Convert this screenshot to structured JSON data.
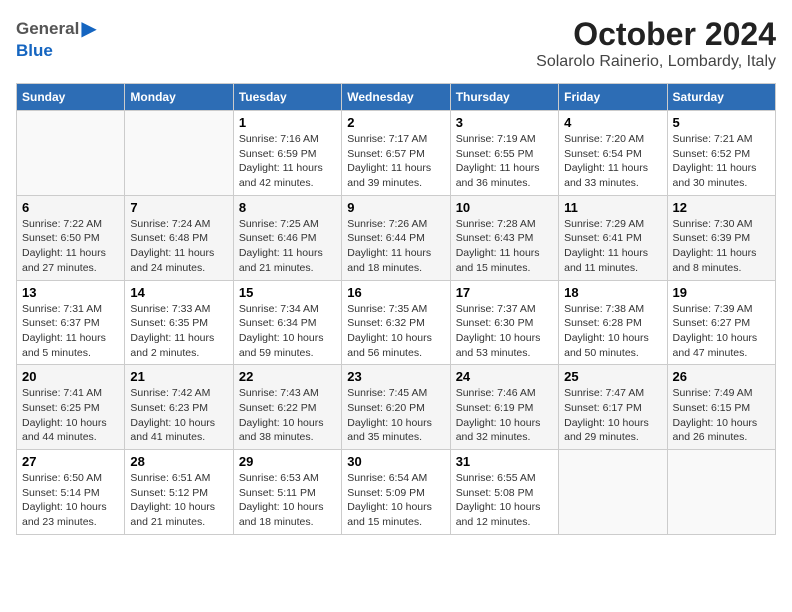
{
  "header": {
    "logo_general": "General",
    "logo_blue": "Blue",
    "month": "October 2024",
    "location": "Solarolo Rainerio, Lombardy, Italy"
  },
  "weekdays": [
    "Sunday",
    "Monday",
    "Tuesday",
    "Wednesday",
    "Thursday",
    "Friday",
    "Saturday"
  ],
  "weeks": [
    [
      {
        "day": "",
        "info": ""
      },
      {
        "day": "",
        "info": ""
      },
      {
        "day": "1",
        "info": "Sunrise: 7:16 AM\nSunset: 6:59 PM\nDaylight: 11 hours and 42 minutes."
      },
      {
        "day": "2",
        "info": "Sunrise: 7:17 AM\nSunset: 6:57 PM\nDaylight: 11 hours and 39 minutes."
      },
      {
        "day": "3",
        "info": "Sunrise: 7:19 AM\nSunset: 6:55 PM\nDaylight: 11 hours and 36 minutes."
      },
      {
        "day": "4",
        "info": "Sunrise: 7:20 AM\nSunset: 6:54 PM\nDaylight: 11 hours and 33 minutes."
      },
      {
        "day": "5",
        "info": "Sunrise: 7:21 AM\nSunset: 6:52 PM\nDaylight: 11 hours and 30 minutes."
      }
    ],
    [
      {
        "day": "6",
        "info": "Sunrise: 7:22 AM\nSunset: 6:50 PM\nDaylight: 11 hours and 27 minutes."
      },
      {
        "day": "7",
        "info": "Sunrise: 7:24 AM\nSunset: 6:48 PM\nDaylight: 11 hours and 24 minutes."
      },
      {
        "day": "8",
        "info": "Sunrise: 7:25 AM\nSunset: 6:46 PM\nDaylight: 11 hours and 21 minutes."
      },
      {
        "day": "9",
        "info": "Sunrise: 7:26 AM\nSunset: 6:44 PM\nDaylight: 11 hours and 18 minutes."
      },
      {
        "day": "10",
        "info": "Sunrise: 7:28 AM\nSunset: 6:43 PM\nDaylight: 11 hours and 15 minutes."
      },
      {
        "day": "11",
        "info": "Sunrise: 7:29 AM\nSunset: 6:41 PM\nDaylight: 11 hours and 11 minutes."
      },
      {
        "day": "12",
        "info": "Sunrise: 7:30 AM\nSunset: 6:39 PM\nDaylight: 11 hours and 8 minutes."
      }
    ],
    [
      {
        "day": "13",
        "info": "Sunrise: 7:31 AM\nSunset: 6:37 PM\nDaylight: 11 hours and 5 minutes."
      },
      {
        "day": "14",
        "info": "Sunrise: 7:33 AM\nSunset: 6:35 PM\nDaylight: 11 hours and 2 minutes."
      },
      {
        "day": "15",
        "info": "Sunrise: 7:34 AM\nSunset: 6:34 PM\nDaylight: 10 hours and 59 minutes."
      },
      {
        "day": "16",
        "info": "Sunrise: 7:35 AM\nSunset: 6:32 PM\nDaylight: 10 hours and 56 minutes."
      },
      {
        "day": "17",
        "info": "Sunrise: 7:37 AM\nSunset: 6:30 PM\nDaylight: 10 hours and 53 minutes."
      },
      {
        "day": "18",
        "info": "Sunrise: 7:38 AM\nSunset: 6:28 PM\nDaylight: 10 hours and 50 minutes."
      },
      {
        "day": "19",
        "info": "Sunrise: 7:39 AM\nSunset: 6:27 PM\nDaylight: 10 hours and 47 minutes."
      }
    ],
    [
      {
        "day": "20",
        "info": "Sunrise: 7:41 AM\nSunset: 6:25 PM\nDaylight: 10 hours and 44 minutes."
      },
      {
        "day": "21",
        "info": "Sunrise: 7:42 AM\nSunset: 6:23 PM\nDaylight: 10 hours and 41 minutes."
      },
      {
        "day": "22",
        "info": "Sunrise: 7:43 AM\nSunset: 6:22 PM\nDaylight: 10 hours and 38 minutes."
      },
      {
        "day": "23",
        "info": "Sunrise: 7:45 AM\nSunset: 6:20 PM\nDaylight: 10 hours and 35 minutes."
      },
      {
        "day": "24",
        "info": "Sunrise: 7:46 AM\nSunset: 6:19 PM\nDaylight: 10 hours and 32 minutes."
      },
      {
        "day": "25",
        "info": "Sunrise: 7:47 AM\nSunset: 6:17 PM\nDaylight: 10 hours and 29 minutes."
      },
      {
        "day": "26",
        "info": "Sunrise: 7:49 AM\nSunset: 6:15 PM\nDaylight: 10 hours and 26 minutes."
      }
    ],
    [
      {
        "day": "27",
        "info": "Sunrise: 6:50 AM\nSunset: 5:14 PM\nDaylight: 10 hours and 23 minutes."
      },
      {
        "day": "28",
        "info": "Sunrise: 6:51 AM\nSunset: 5:12 PM\nDaylight: 10 hours and 21 minutes."
      },
      {
        "day": "29",
        "info": "Sunrise: 6:53 AM\nSunset: 5:11 PM\nDaylight: 10 hours and 18 minutes."
      },
      {
        "day": "30",
        "info": "Sunrise: 6:54 AM\nSunset: 5:09 PM\nDaylight: 10 hours and 15 minutes."
      },
      {
        "day": "31",
        "info": "Sunrise: 6:55 AM\nSunset: 5:08 PM\nDaylight: 10 hours and 12 minutes."
      },
      {
        "day": "",
        "info": ""
      },
      {
        "day": "",
        "info": ""
      }
    ]
  ]
}
